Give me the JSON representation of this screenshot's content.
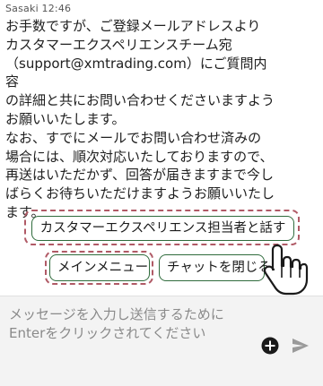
{
  "chat": {
    "sender": "Sasaki",
    "time": "12:46",
    "message_lines": [
      "お手数ですが、ご登録メールアドレスより",
      "カスタマーエクスペリエンスチーム宛",
      "（support@xmtrading.com）にご質問内容",
      "の詳細と共にお問い合わせくださいますよう",
      "お願いいたします。",
      "なお、すでにメールでお問い合わせ済みの",
      "場合には、順次対応いたしておりますので、",
      "再送はいただかず、回答が届きますまで今し",
      "ばらくお待ちいただけますようお願いいたし",
      "ます。"
    ]
  },
  "quick_replies": {
    "talk_to_agent": "カスタマーエクスペリエンス担当者と話す",
    "main_menu": "メインメニュー",
    "close_chat": "チャットを閉じる"
  },
  "composer": {
    "placeholder": "メッセージを入力し送信するためにEnterをクリックされてください"
  },
  "icons": {
    "add": "plus-circle-icon",
    "send": "send-icon",
    "pointer": "hand-pointer-icon"
  },
  "colors": {
    "button_border": "#2f6b3c",
    "highlight_border": "#b05a66",
    "composer_bg": "#f3f3f3"
  }
}
